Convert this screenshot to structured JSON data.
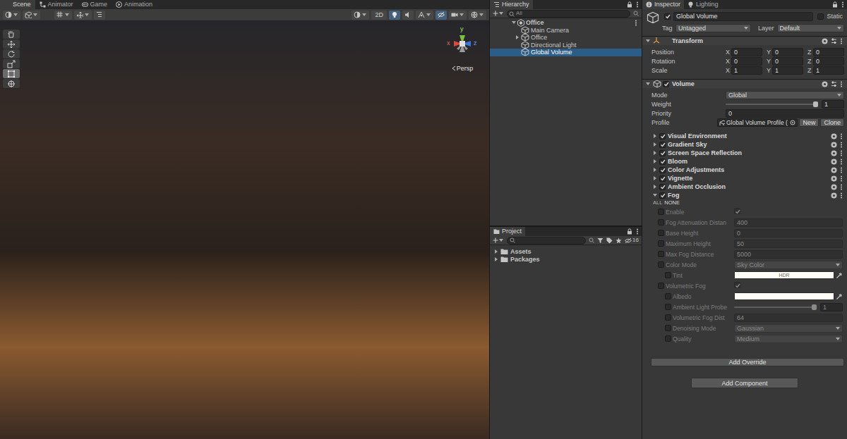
{
  "scene": {
    "tabs": [
      {
        "label": "Scene",
        "selected": true,
        "kind": "scene"
      },
      {
        "label": "Animator",
        "selected": false,
        "kind": "animator"
      },
      {
        "label": "Game",
        "selected": false,
        "kind": "game"
      },
      {
        "label": "Animation",
        "selected": false,
        "kind": "animation"
      }
    ],
    "toolbar": {
      "mode_2d": {
        "label": "2D",
        "on": false
      },
      "lighting_on": true,
      "visibility_on": true
    },
    "tools": [
      {
        "kind": "hand",
        "selected": false
      },
      {
        "kind": "move",
        "selected": false
      },
      {
        "kind": "rotate",
        "selected": false
      },
      {
        "kind": "scale",
        "selected": false
      },
      {
        "kind": "rect",
        "selected": true
      },
      {
        "kind": "transform",
        "selected": false
      }
    ],
    "gizmo": {
      "x": "x",
      "y": "y",
      "z": "z",
      "projection": "Persp"
    }
  },
  "hierarchy": {
    "tabs": [
      {
        "label": "Hierarchy",
        "selected": true,
        "kind": "hierarchy"
      }
    ],
    "search_placeholder": "All",
    "items": [
      {
        "label": "Office",
        "kind": "scene",
        "has_children": true,
        "expanded": true,
        "selected": false
      },
      {
        "label": "Main Camera",
        "kind": "object",
        "has_children": false,
        "expanded": false,
        "selected": false
      },
      {
        "label": "Office",
        "kind": "object",
        "has_children": true,
        "expanded": false,
        "selected": false
      },
      {
        "label": "Directional Light",
        "kind": "object",
        "has_children": false,
        "expanded": false,
        "selected": false
      },
      {
        "label": "Global Volume",
        "kind": "object",
        "has_children": false,
        "expanded": false,
        "selected": true
      }
    ]
  },
  "project": {
    "tabs": [
      {
        "label": "Project",
        "selected": true,
        "kind": "project"
      }
    ],
    "hidden_count": "16",
    "items": [
      {
        "label": "Assets",
        "expanded": false
      },
      {
        "label": "Packages",
        "expanded": false
      }
    ]
  },
  "inspector": {
    "tabs": [
      {
        "label": "Inspector",
        "selected": true,
        "kind": "inspector"
      },
      {
        "label": "Lighting",
        "selected": false,
        "kind": "lighting"
      }
    ],
    "object": {
      "name": "Global Volume",
      "active": true,
      "static_label": "Static",
      "static": false,
      "tag_label": "Tag",
      "tag": "Untagged",
      "layer_label": "Layer",
      "layer": "Default"
    },
    "transform": {
      "title": "Transform",
      "expanded": true,
      "rows": [
        {
          "label": "Position",
          "values": [
            {
              "axis": "X",
              "value": "0"
            },
            {
              "axis": "Y",
              "value": "0"
            },
            {
              "axis": "Z",
              "value": "0"
            }
          ]
        },
        {
          "label": "Rotation",
          "values": [
            {
              "axis": "X",
              "value": "0"
            },
            {
              "axis": "Y",
              "value": "0"
            },
            {
              "axis": "Z",
              "value": "0"
            }
          ]
        },
        {
          "label": "Scale",
          "values": [
            {
              "axis": "X",
              "value": "1"
            },
            {
              "axis": "Y",
              "value": "1"
            },
            {
              "axis": "Z",
              "value": "1"
            }
          ]
        }
      ]
    },
    "volume": {
      "title": "Volume",
      "enabled": true,
      "expanded": true,
      "mode": {
        "label": "Mode",
        "value": "Global"
      },
      "weight": {
        "label": "Weight",
        "level": 1,
        "value": "1"
      },
      "priority": {
        "label": "Priority",
        "value": "0"
      },
      "profile": {
        "label": "Profile",
        "value": "Global Volume Profile (",
        "buttons": [
          "New",
          "Clone"
        ]
      },
      "overrides": [
        {
          "label": "Visual Environment",
          "enabled": true,
          "expanded": false
        },
        {
          "label": "Gradient Sky",
          "enabled": true,
          "expanded": false
        },
        {
          "label": "Screen Space Reflection",
          "enabled": true,
          "expanded": false
        },
        {
          "label": "Bloom",
          "enabled": true,
          "expanded": false
        },
        {
          "label": "Color Adjustments",
          "enabled": true,
          "expanded": false
        },
        {
          "label": "Vignette",
          "enabled": true,
          "expanded": false
        },
        {
          "label": "Ambient Occlusion",
          "enabled": true,
          "expanded": false
        },
        {
          "label": "Fog",
          "enabled": true,
          "expanded": true
        }
      ],
      "fog": {
        "all": "ALL",
        "none": "NONE",
        "fields": [
          {
            "kind": "toggle",
            "label": "Enable",
            "override": false,
            "nested": false,
            "checked": true
          },
          {
            "kind": "number",
            "label": "Fog Attenuation Distan",
            "override": false,
            "nested": false,
            "value": "400"
          },
          {
            "kind": "number",
            "label": "Base Height",
            "override": false,
            "nested": false,
            "value": "0"
          },
          {
            "kind": "number",
            "label": "Maximum Height",
            "override": false,
            "nested": false,
            "value": "50"
          },
          {
            "kind": "number",
            "label": "Max Fog Distance",
            "override": false,
            "nested": false,
            "value": "5000"
          },
          {
            "kind": "dropdown",
            "label": "Color Mode",
            "override": false,
            "nested": false,
            "value": "Sky Color"
          },
          {
            "kind": "color",
            "label": "Tint",
            "override": false,
            "nested": true,
            "color": "#fffdf5",
            "badge": "HDR"
          },
          {
            "kind": "toggle",
            "label": "Volumetric Fog",
            "override": false,
            "nested": false,
            "checked": true
          },
          {
            "kind": "color",
            "label": "Albedo",
            "override": false,
            "nested": true,
            "color": "#fffdf5"
          },
          {
            "kind": "slider",
            "label": "Ambient Light Probe",
            "override": false,
            "nested": true,
            "level": 1,
            "value": "1"
          },
          {
            "kind": "number",
            "label": "Volumetric Fog Dist",
            "override": false,
            "nested": true,
            "value": "64"
          },
          {
            "kind": "dropdown",
            "label": "Denoising Mode",
            "override": false,
            "nested": true,
            "value": "Gaussian"
          },
          {
            "kind": "dropdown",
            "label": "Quality",
            "override": false,
            "nested": true,
            "value": "Medium"
          }
        ]
      }
    },
    "add_override": "Add Override",
    "add_component": "Add Component"
  }
}
